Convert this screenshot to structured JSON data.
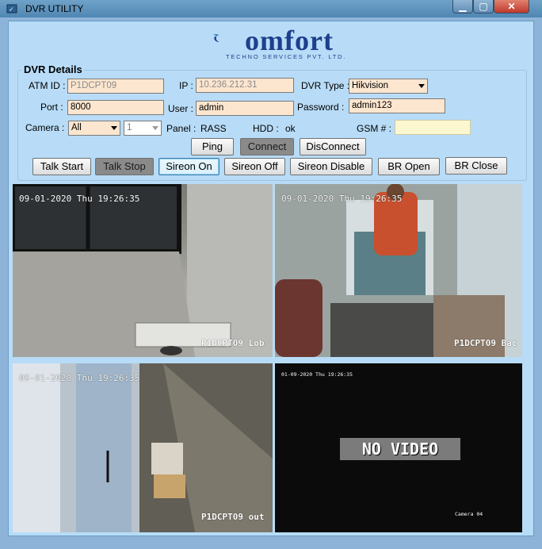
{
  "window": {
    "title": "DVR UTILITY",
    "min": "▁",
    "max": "▢",
    "close": "✕"
  },
  "logo": {
    "brand": "omfort",
    "tagline": "TECHNO SERVICES PVT. LTD."
  },
  "details": {
    "group_title": "DVR Details",
    "atm_label": "ATM ID :",
    "atm_value": "P1DCPT09",
    "ip_label": "IP :",
    "ip_value": "10.236.212.31",
    "dvrtype_label": "DVR Type :",
    "dvrtype_value": "Hikvision",
    "port_label": "Port :",
    "port_value": "8000",
    "user_label": "User :",
    "user_value": "admin",
    "password_label": "Password :",
    "password_value": "admin123",
    "camera_label": "Camera :",
    "camera_value": "All",
    "channel_value": "1",
    "panel_label": "Panel :",
    "panel_value": "RASS",
    "hdd_label": "HDD :",
    "hdd_value": "ok",
    "gsm_label": "GSM # :",
    "gsm_value": ""
  },
  "buttons": {
    "ping": "Ping",
    "connect": "Connect",
    "disconnect": "DisConnect",
    "talk_start": "Talk Start",
    "talk_stop": "Talk Stop",
    "sireon_on": "Sireon On",
    "sireon_off": "Sireon Off",
    "sireon_disable": "Sireon Disable",
    "br_open": "BR Open",
    "br_close": "BR Close"
  },
  "cameras": [
    {
      "timestamp": "09-01-2020 Thu 19:26:35",
      "name": "P1DCPT09 Lob"
    },
    {
      "timestamp": "09-01-2020 Thu 19:26:35",
      "name": "P1DCPT09 Bac"
    },
    {
      "timestamp": "09-01-2020 Thu 19:26:35",
      "name": "P1DCPT09 out"
    },
    {
      "timestamp": "01-09-2020 Thu 19:26:35",
      "no_video": "NO VIDEO",
      "channel": "Camera 04"
    }
  ]
}
